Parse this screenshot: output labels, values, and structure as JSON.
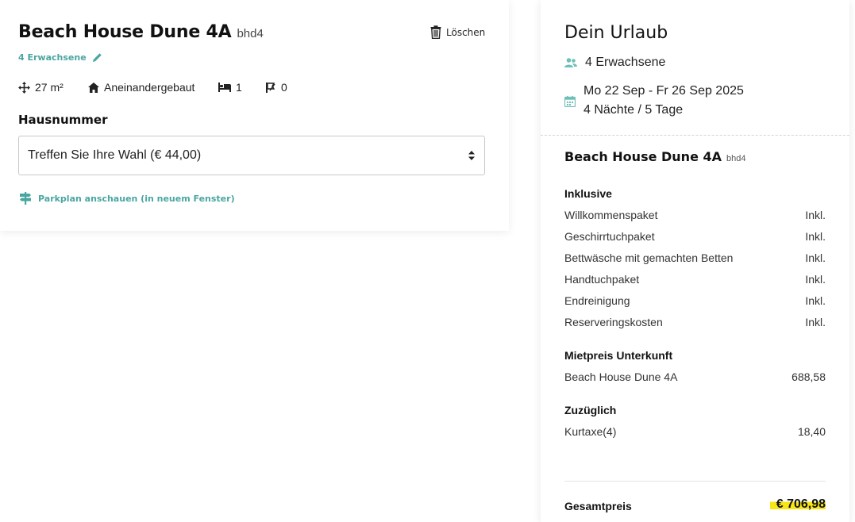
{
  "unit": {
    "name": "Beach House Dune 4A",
    "code": "bhd4",
    "delete_label": "Löschen",
    "guests_label": "4 Erwachsene",
    "features": {
      "area": "27 m²",
      "type": "Aneinandergebaut",
      "bedrooms": "1",
      "pets": "0"
    },
    "house_number_label": "Hausnummer",
    "house_number_select": "Treffen Sie Ihre Wahl (€ 44,00)",
    "parking_link": "Parkplan anschauen (in neuem Fenster)"
  },
  "summary": {
    "title": "Dein Urlaub",
    "guests": "4 Erwachsene",
    "dates": "Mo 22 Sep - Fr 26 Sep 2025",
    "duration": "4 Nächte / 5 Tage",
    "unit_name": "Beach House Dune 4A",
    "unit_code": "bhd4",
    "included": {
      "heading": "Inklusive",
      "items": [
        {
          "label": "Willkommenspaket",
          "value": "Inkl."
        },
        {
          "label": "Geschirrtuchpaket",
          "value": "Inkl."
        },
        {
          "label": "Bettwäsche mit gemachten Betten",
          "value": "Inkl."
        },
        {
          "label": "Handtuchpaket",
          "value": "Inkl."
        },
        {
          "label": "Endreinigung",
          "value": "Inkl."
        },
        {
          "label": "Reserveringskosten",
          "value": "Inkl."
        }
      ]
    },
    "rent": {
      "heading": "Mietpreis Unterkunft",
      "items": [
        {
          "label": "Beach House Dune 4A",
          "value": "688,58"
        }
      ]
    },
    "extra": {
      "heading": "Zuzüglich",
      "items": [
        {
          "label": "Kurtaxe(4)",
          "value": "18,40"
        }
      ]
    },
    "total_label": "Gesamtpreis",
    "total_value": "€ 706,98"
  },
  "colors": {
    "accent": "#4aa6a0",
    "highlight": "#f7e514"
  },
  "icons": {
    "trash": "trash-icon",
    "pencil": "pencil-icon",
    "area": "move-arrows-icon",
    "house": "house-icon",
    "bed": "bed-icon",
    "pet": "pet-icon",
    "select": "select-arrows-icon",
    "signpost": "signpost-icon",
    "users": "users-icon",
    "calendar": "calendar-icon"
  }
}
